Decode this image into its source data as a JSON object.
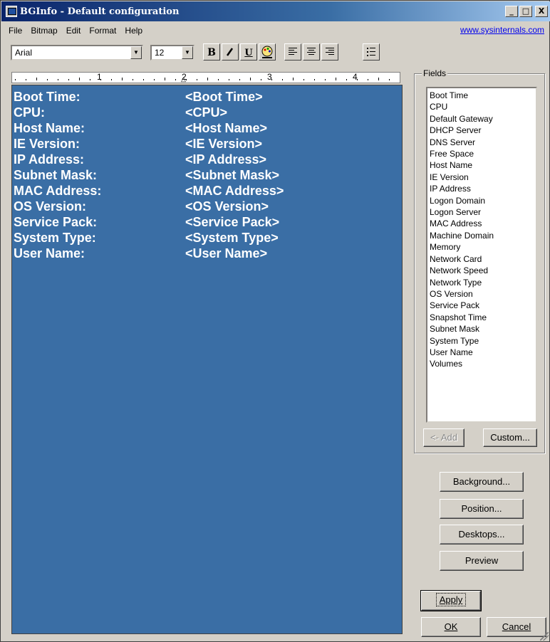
{
  "window": {
    "title": "BGInfo - Default configuration",
    "buttons": {
      "minimize": "_",
      "maximize": "□",
      "close": "X"
    }
  },
  "menu": {
    "items": [
      {
        "label": "File"
      },
      {
        "label": "Bitmap"
      },
      {
        "label": "Edit"
      },
      {
        "label": "Format"
      },
      {
        "label": "Help"
      }
    ],
    "link": "www.sysinternals.com"
  },
  "toolbar": {
    "font": "Arial",
    "size": "12",
    "bold": "B",
    "italic": "I",
    "underline": "U"
  },
  "ruler": {
    "numbers": [
      "1",
      "2",
      "3",
      "4"
    ]
  },
  "editor": {
    "background_color": "#3a6ea5",
    "rows": [
      {
        "label": "Boot Time:",
        "value": "<Boot Time>"
      },
      {
        "label": "CPU:",
        "value": "<CPU>"
      },
      {
        "label": "Host Name:",
        "value": "<Host Name>"
      },
      {
        "label": "IE Version:",
        "value": "<IE Version>"
      },
      {
        "label": "IP Address:",
        "value": "<IP Address>"
      },
      {
        "label": "Subnet Mask:",
        "value": "<Subnet Mask>"
      },
      {
        "label": "MAC Address:",
        "value": "<MAC Address>"
      },
      {
        "label": "OS Version:",
        "value": "<OS Version>"
      },
      {
        "label": "Service Pack:",
        "value": "<Service Pack>"
      },
      {
        "label": "System Type:",
        "value": "<System Type>"
      },
      {
        "label": "User Name:",
        "value": "<User Name>"
      }
    ]
  },
  "fields": {
    "title": "Fields",
    "items": [
      "Boot Time",
      "CPU",
      "Default Gateway",
      "DHCP Server",
      "DNS Server",
      "Free Space",
      "Host Name",
      "IE Version",
      "IP Address",
      "Logon Domain",
      "Logon Server",
      "MAC Address",
      "Machine Domain",
      "Memory",
      "Network Card",
      "Network Speed",
      "Network Type",
      "OS Version",
      "Service Pack",
      "Snapshot Time",
      "Subnet Mask",
      "System Type",
      "User Name",
      "Volumes"
    ],
    "add_label": "<- Add",
    "custom_label": "Custom..."
  },
  "actions": {
    "background": "Background...",
    "position": "Position...",
    "desktops": "Desktops...",
    "preview": "Preview",
    "apply": "Apply",
    "ok": "OK",
    "cancel": "Cancel"
  }
}
